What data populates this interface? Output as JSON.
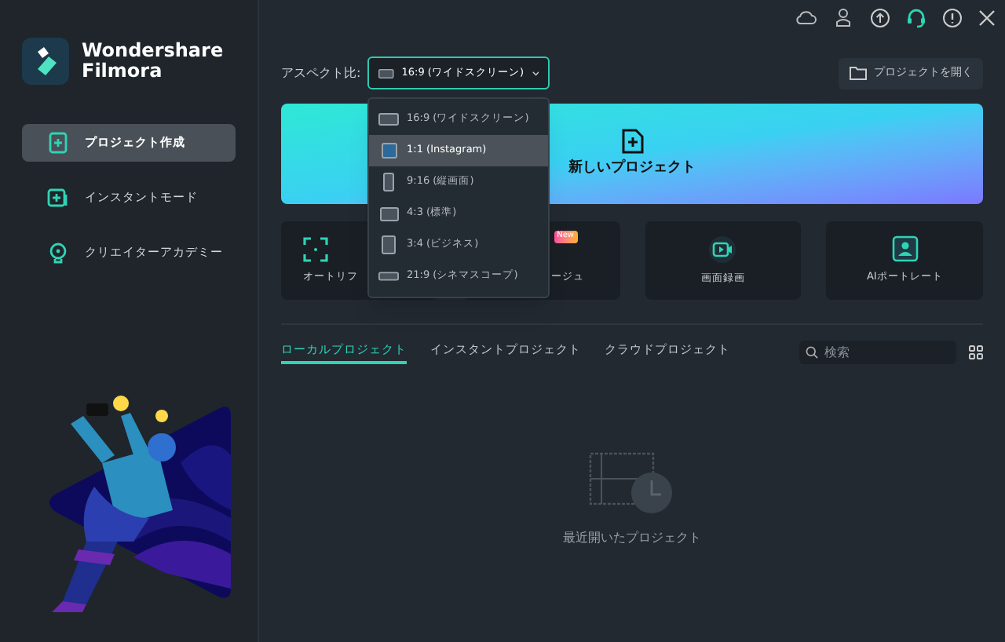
{
  "brand": {
    "line_1": "Wondershare",
    "line_2": "Filmora"
  },
  "sidebar": {
    "items": [
      {
        "label": "プロジェクト作成",
        "kind": "create",
        "selected": true
      },
      {
        "label": "インスタントモード",
        "kind": "instant",
        "selected": false
      },
      {
        "label": "クリエイターアカデミー",
        "kind": "academy",
        "selected": false
      }
    ]
  },
  "aspect": {
    "label": "アスペクト比:",
    "value": "16:9 (ワイドスクリーン)",
    "expanded": true,
    "options": [
      {
        "label": "16:9 (ワイドスクリーン)",
        "kind": "wide",
        "highlighted": false
      },
      {
        "label": "1:1 (Instagram)",
        "kind": "square",
        "highlighted": true
      },
      {
        "label": "9:16 (縦画面)",
        "kind": "tall",
        "highlighted": false
      },
      {
        "label": "4:3 (標準)",
        "kind": "standard",
        "highlighted": false
      },
      {
        "label": "3:4 (ビジネス)",
        "kind": "portrait",
        "highlighted": false
      },
      {
        "label": "21:9 (シネマスコープ)",
        "kind": "cinema",
        "highlighted": false
      }
    ]
  },
  "open_button": "プロジェクトを開く",
  "new_project": "新しいプロジェクト",
  "features": [
    {
      "label": "オートリフ",
      "kind": "reframe"
    },
    {
      "label": "ージュ",
      "kind": "hidden",
      "badge": "New"
    },
    {
      "label": "画面録画",
      "kind": "record"
    },
    {
      "label": "AIポートレート",
      "kind": "portrait"
    }
  ],
  "tabs": [
    {
      "label": "ローカルプロジェクト",
      "selected": true
    },
    {
      "label": "インスタントプロジェクト",
      "selected": false
    },
    {
      "label": "クラウドプロジェクト",
      "selected": false
    }
  ],
  "search": {
    "placeholder": "検索"
  },
  "empty_state": "最近開いたプロジェクト"
}
